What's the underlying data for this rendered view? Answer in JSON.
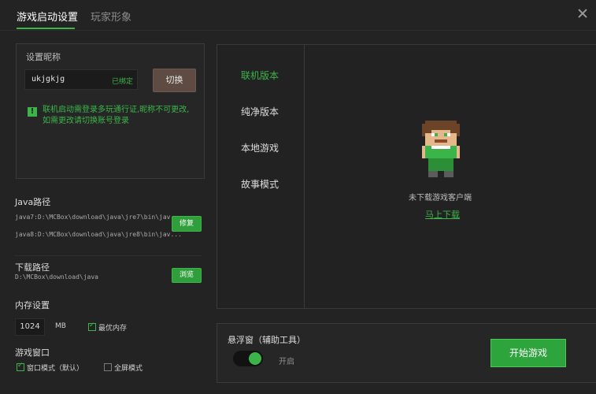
{
  "tabs": [
    {
      "label": "游戏启动设置",
      "active": true
    },
    {
      "label": "玩家形象",
      "active": false
    }
  ],
  "nickname": {
    "title": "设置昵称",
    "value": "ukjgkjg",
    "bound_label": "已绑定",
    "switch_label": "切换",
    "warning_line1": "联机启动需登录多玩通行证,昵称不可更改,",
    "warning_line2": "如需更改请切换账号登录"
  },
  "java": {
    "title": "Java路径",
    "path1": "java7:D:\\MCBox\\download\\java\\jre7\\bin\\jav...",
    "path2": "java8:D:\\MCBox\\download\\java\\jre8\\bin\\jav...",
    "repair_label": "修复"
  },
  "download": {
    "title": "下载路径",
    "path": "D:\\MCBox\\download\\java",
    "browse_label": "浏览"
  },
  "memory": {
    "title": "内存设置",
    "value": "1024",
    "unit": "MB",
    "optimal_label": "最优内存",
    "optimal_checked": true
  },
  "window": {
    "title": "游戏窗口",
    "windowed_label": "窗口模式（默认）",
    "windowed_checked": true,
    "fullscreen_label": "全屏模式",
    "fullscreen_checked": false
  },
  "versions": {
    "items": [
      "联机版本",
      "纯净版本",
      "本地游戏",
      "故事模式"
    ],
    "active_index": 0,
    "not_downloaded": "未下载游戏客户端",
    "download_now": "马上下载"
  },
  "floating": {
    "title": "悬浮窗（辅助工具）",
    "toggle_label": "开启",
    "enabled": true
  },
  "start_button": "开始游戏",
  "colors": {
    "accent": "#3bb54a",
    "background": "#232323",
    "switch_button": "#5e4c42"
  }
}
